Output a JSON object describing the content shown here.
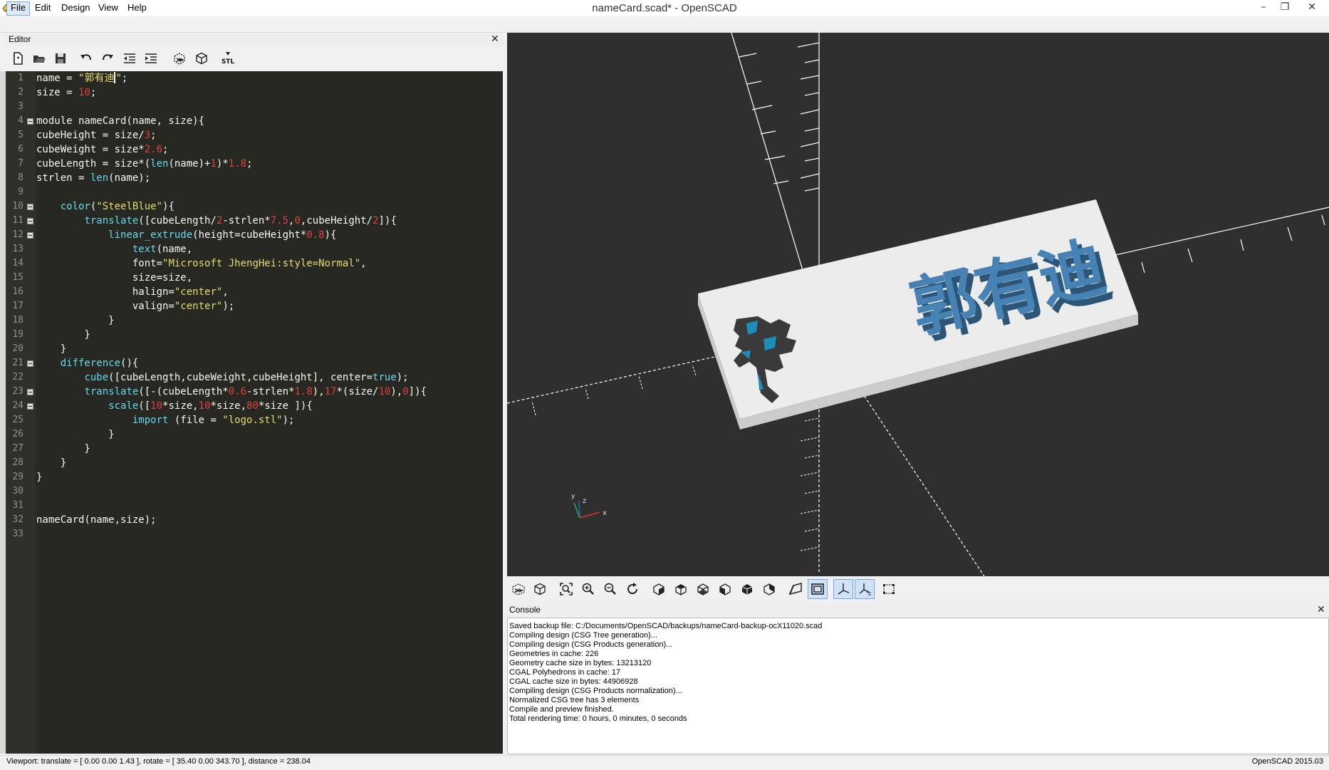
{
  "window": {
    "title": "nameCard.scad* - OpenSCAD",
    "minimize": "–",
    "restore": "❐",
    "close": "✕"
  },
  "menu": [
    "File",
    "Edit",
    "Design",
    "View",
    "Help"
  ],
  "editor": {
    "label": "Editor",
    "close": "✕",
    "toolbar_icons": [
      "new-file-icon",
      "open-file-icon",
      "save-icon",
      "undo-icon",
      "redo-icon",
      "unindent-icon",
      "indent-icon",
      "preview-icon",
      "render-icon",
      "export-stl-icon"
    ],
    "stl_label": "STL",
    "lines": [
      [
        {
          "t": "name = "
        },
        {
          "t": "\"郭有迪",
          "c": "str"
        },
        {
          "cursor": true
        },
        {
          "t": "\"",
          "c": "str"
        },
        {
          "t": ";"
        }
      ],
      [
        {
          "t": "size = "
        },
        {
          "t": "10",
          "c": "num"
        },
        {
          "t": ";"
        }
      ],
      [],
      [
        {
          "t": "module nameCard(name, size){"
        }
      ],
      [
        {
          "t": "cubeHeight = size/"
        },
        {
          "t": "3",
          "c": "num"
        },
        {
          "t": ";"
        }
      ],
      [
        {
          "t": "cubeWeight = size*"
        },
        {
          "t": "2.6",
          "c": "num"
        },
        {
          "t": ";"
        }
      ],
      [
        {
          "t": "cubeLength = size*("
        },
        {
          "t": "len",
          "c": "fn"
        },
        {
          "t": "(name)+"
        },
        {
          "t": "1",
          "c": "num"
        },
        {
          "t": ")*"
        },
        {
          "t": "1.8",
          "c": "num"
        },
        {
          "t": ";"
        }
      ],
      [
        {
          "t": "strlen = "
        },
        {
          "t": "len",
          "c": "fn"
        },
        {
          "t": "(name);"
        }
      ],
      [],
      [
        {
          "t": "    "
        },
        {
          "t": "color",
          "c": "fn"
        },
        {
          "t": "("
        },
        {
          "t": "\"SteelBlue\"",
          "c": "str"
        },
        {
          "t": "){"
        }
      ],
      [
        {
          "t": "        "
        },
        {
          "t": "translate",
          "c": "fn"
        },
        {
          "t": "([cubeLength/"
        },
        {
          "t": "2",
          "c": "num"
        },
        {
          "t": "-strlen*"
        },
        {
          "t": "7.5",
          "c": "num"
        },
        {
          "t": ","
        },
        {
          "t": "0",
          "c": "num"
        },
        {
          "t": ",cubeHeight/"
        },
        {
          "t": "2",
          "c": "num"
        },
        {
          "t": "]){"
        }
      ],
      [
        {
          "t": "            "
        },
        {
          "t": "linear_extrude",
          "c": "fn"
        },
        {
          "t": "(height=cubeHeight*"
        },
        {
          "t": "0.8",
          "c": "num"
        },
        {
          "t": "){"
        }
      ],
      [
        {
          "t": "                "
        },
        {
          "t": "text",
          "c": "fn"
        },
        {
          "t": "(name,"
        }
      ],
      [
        {
          "t": "                font="
        },
        {
          "t": "\"Microsoft JhengHei:style=Normal\"",
          "c": "str"
        },
        {
          "t": ","
        }
      ],
      [
        {
          "t": "                size=size,"
        }
      ],
      [
        {
          "t": "                halign="
        },
        {
          "t": "\"center\"",
          "c": "str"
        },
        {
          "t": ","
        }
      ],
      [
        {
          "t": "                valign="
        },
        {
          "t": "\"center\"",
          "c": "str"
        },
        {
          "t": ");"
        }
      ],
      [
        {
          "t": "            }"
        }
      ],
      [
        {
          "t": "        }"
        }
      ],
      [
        {
          "t": "    }"
        }
      ],
      [
        {
          "t": "    "
        },
        {
          "t": "difference",
          "c": "fn"
        },
        {
          "t": "(){"
        }
      ],
      [
        {
          "t": "        "
        },
        {
          "t": "cube",
          "c": "fn"
        },
        {
          "t": "([cubeLength,cubeWeight,cubeHeight], center="
        },
        {
          "t": "true",
          "c": "fn"
        },
        {
          "t": ");"
        }
      ],
      [
        {
          "t": "        "
        },
        {
          "t": "translate",
          "c": "fn"
        },
        {
          "t": "([-(cubeLength*"
        },
        {
          "t": "0.6",
          "c": "num"
        },
        {
          "t": "-strlen*"
        },
        {
          "t": "1.8",
          "c": "num"
        },
        {
          "t": "),"
        },
        {
          "t": "17",
          "c": "num"
        },
        {
          "t": "*(size/"
        },
        {
          "t": "10",
          "c": "num"
        },
        {
          "t": "),"
        },
        {
          "t": "0",
          "c": "num"
        },
        {
          "t": "]){"
        }
      ],
      [
        {
          "t": "            "
        },
        {
          "t": "scale",
          "c": "fn"
        },
        {
          "t": "(["
        },
        {
          "t": "10",
          "c": "num"
        },
        {
          "t": "*size,"
        },
        {
          "t": "10",
          "c": "num"
        },
        {
          "t": "*size,"
        },
        {
          "t": "80",
          "c": "num"
        },
        {
          "t": "*size ]){"
        }
      ],
      [
        {
          "t": "                "
        },
        {
          "t": "import",
          "c": "fn"
        },
        {
          "t": " (file = "
        },
        {
          "t": "\"logo.stl\"",
          "c": "str"
        },
        {
          "t": ");"
        }
      ],
      [
        {
          "t": "            }"
        }
      ],
      [
        {
          "t": "        }"
        }
      ],
      [
        {
          "t": "    }"
        }
      ],
      [
        {
          "t": "}"
        }
      ],
      [],
      [],
      [
        {
          "t": "nameCard(name,size);"
        }
      ],
      []
    ],
    "fold_lines": [
      4,
      10,
      11,
      12,
      21,
      23,
      24
    ]
  },
  "viewport": {
    "background": "#2f2f2f",
    "plate_top": "#ececec",
    "plate_side": "#cccccc",
    "text_color": "#4682b4",
    "text_shadow": "#2c5577",
    "model_text": "郭有迪",
    "axes_labels": {
      "z": "z",
      "x": "x",
      "y": "y"
    },
    "toolbar_icons": [
      "preview-icon",
      "render-icon",
      "view-all-icon",
      "zoom-in-icon",
      "zoom-out-icon",
      "reset-view-icon",
      "view-right-icon",
      "view-top-icon",
      "view-bottom-icon",
      "view-left-icon",
      "view-front-icon",
      "view-back-icon",
      "perspective-icon",
      "orthogonal-icon",
      "show-axes-icon",
      "show-scale-markers-icon",
      "show-edges-icon"
    ]
  },
  "console": {
    "label": "Console",
    "close": "✕",
    "lines": [
      "Saved backup file: C:/Documents/OpenSCAD/backups/nameCard-backup-ocX11020.scad",
      "Compiling design (CSG Tree generation)...",
      "Compiling design (CSG Products generation)...",
      "Geometries in cache: 226",
      "Geometry cache size in bytes: 13213120",
      "CGAL Polyhedrons in cache: 17",
      "CGAL cache size in bytes: 44906928",
      "Compiling design (CSG Products normalization)...",
      "Normalized CSG tree has 3 elements",
      "Compile and preview finished.",
      "Total rendering time: 0 hours, 0 minutes, 0 seconds"
    ]
  },
  "status": {
    "viewport": "Viewport: translate = [ 0.00 0.00 1.43 ], rotate = [ 35.40 0.00 343.70 ], distance = 238.04",
    "version": "OpenSCAD 2015.03"
  }
}
